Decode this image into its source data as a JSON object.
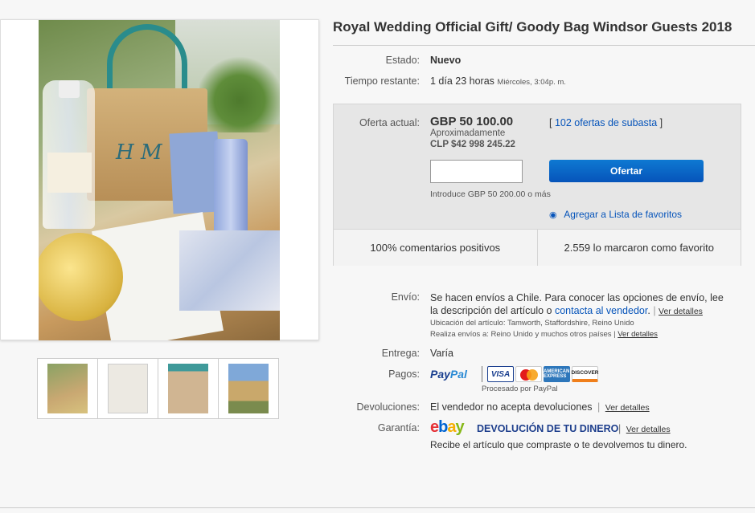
{
  "listing": {
    "title": "Royal Wedding Official Gift/ Goody Bag Windsor Guests 2018",
    "condition_label": "Estado:",
    "condition_value": "Nuevo",
    "time_label": "Tiempo restante:",
    "time_value": "1 día 23 horas",
    "time_end": "Miércoles, 3:04p. m."
  },
  "offer": {
    "label": "Oferta actual:",
    "price": "GBP 50 100.00",
    "approx_label": "Aproximadamente",
    "approx_value": "CLP $42 998 245.22",
    "bids_link": "102 ofertas de subasta",
    "bracket_open": "[",
    "bracket_close": "]",
    "input_placeholder": "",
    "bid_button": "Ofertar",
    "min_bid_hint": "Introduce GBP 50 200.00 o más",
    "watchlist_link": "Agregar a Lista de favoritos",
    "feedback": "100% comentarios positivos",
    "watchers": "2.559 lo marcaron como favorito"
  },
  "shipping": {
    "label": "Envío:",
    "text_line1": "Se hacen envíos a Chile. Para conocer las opciones de envío, lee",
    "text_line2_prefix": "la descripción del artículo o",
    "contact_link": "contacta al vendedor",
    "text_line2_suffix": ".",
    "details_link": "Ver detalles",
    "location_label": "Ubicación del artículo:",
    "location_value": "Tamworth, Staffordshire, Reino Unido",
    "ships_to_label": "Realiza envíos a:",
    "ships_to_value": "Reino Unido y muchos otros países",
    "ships_to_details": "Ver detalles"
  },
  "delivery": {
    "label": "Entrega:",
    "value": "Varía"
  },
  "payments": {
    "label": "Pagos:",
    "paypal_a": "Pay",
    "paypal_b": "Pal",
    "processed_by": "Procesado por PayPal",
    "cards": [
      "VISA",
      "",
      "AMERICAN EXPRESS",
      "DISCOVER"
    ]
  },
  "returns": {
    "label": "Devoluciones:",
    "value": "El vendedor no acepta devoluciones",
    "details_link": "Ver detalles"
  },
  "guarantee": {
    "label": "Garantía:",
    "ebay_letters": [
      "e",
      "b",
      "a",
      "y"
    ],
    "money_back": "DEVOLUCIÓN DE TU DINERO",
    "details_link": "Ver detalles",
    "description": "Recibe el artículo que compraste o te devolvemos tu dinero."
  },
  "colors": {
    "link": "#0654ba",
    "button": "#0654ba",
    "offer_box": "#e6e6e6"
  }
}
